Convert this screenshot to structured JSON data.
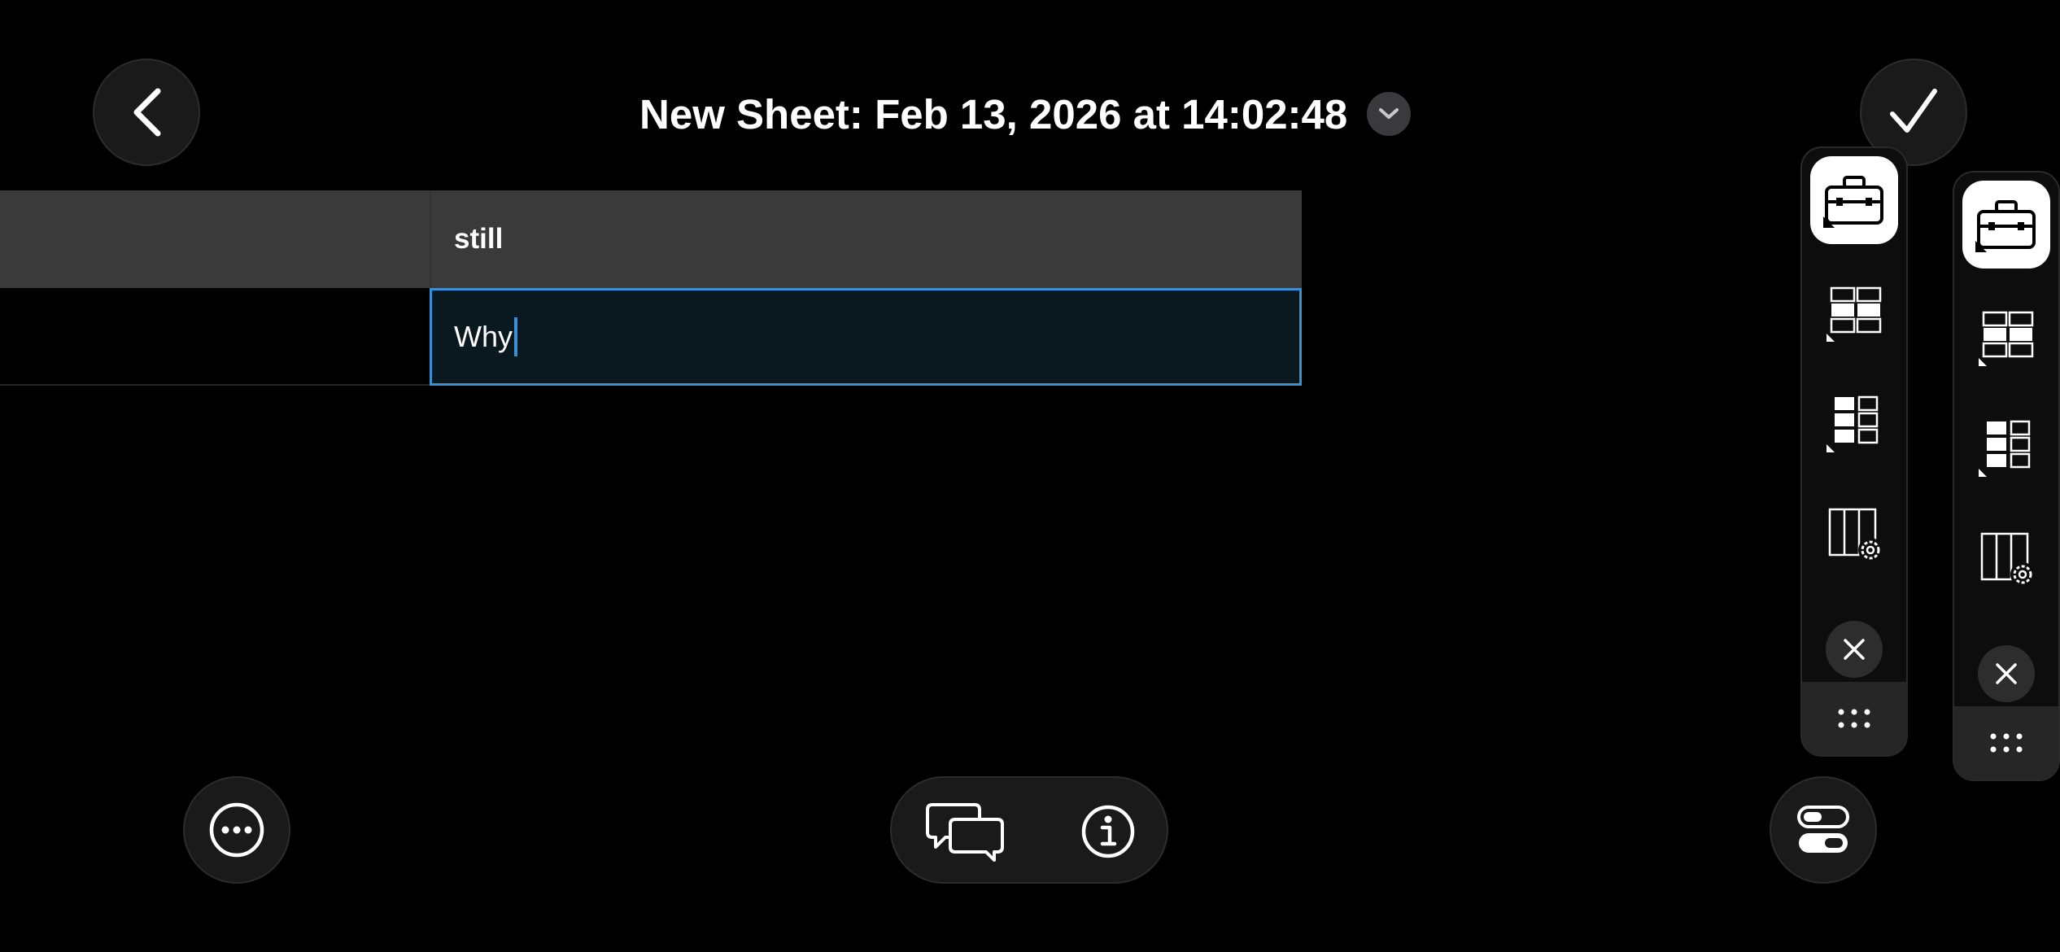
{
  "header": {
    "title": "New Sheet: Feb 13, 2026 at 14:02:48"
  },
  "sheet": {
    "columns": [
      "still"
    ],
    "active_cell_value": "Why"
  },
  "colors": {
    "background": "#000000",
    "accent": "#3b8fd4",
    "header_row": "#3a3a3a",
    "button_fill": "#1a1a1a"
  },
  "icons": {
    "back": "chevron-left-icon",
    "done": "checkmark-icon",
    "title_menu": "chevron-down-icon",
    "more": "ellipsis-circle-icon",
    "comments": "speech-bubbles-icon",
    "info": "info-circle-icon",
    "toggles": "toggle-switches-icon",
    "toolbar": [
      "toolbox-icon",
      "table-grid-icon",
      "row-grid-icon",
      "column-settings-icon",
      "close-icon",
      "drag-handle-icon"
    ]
  }
}
